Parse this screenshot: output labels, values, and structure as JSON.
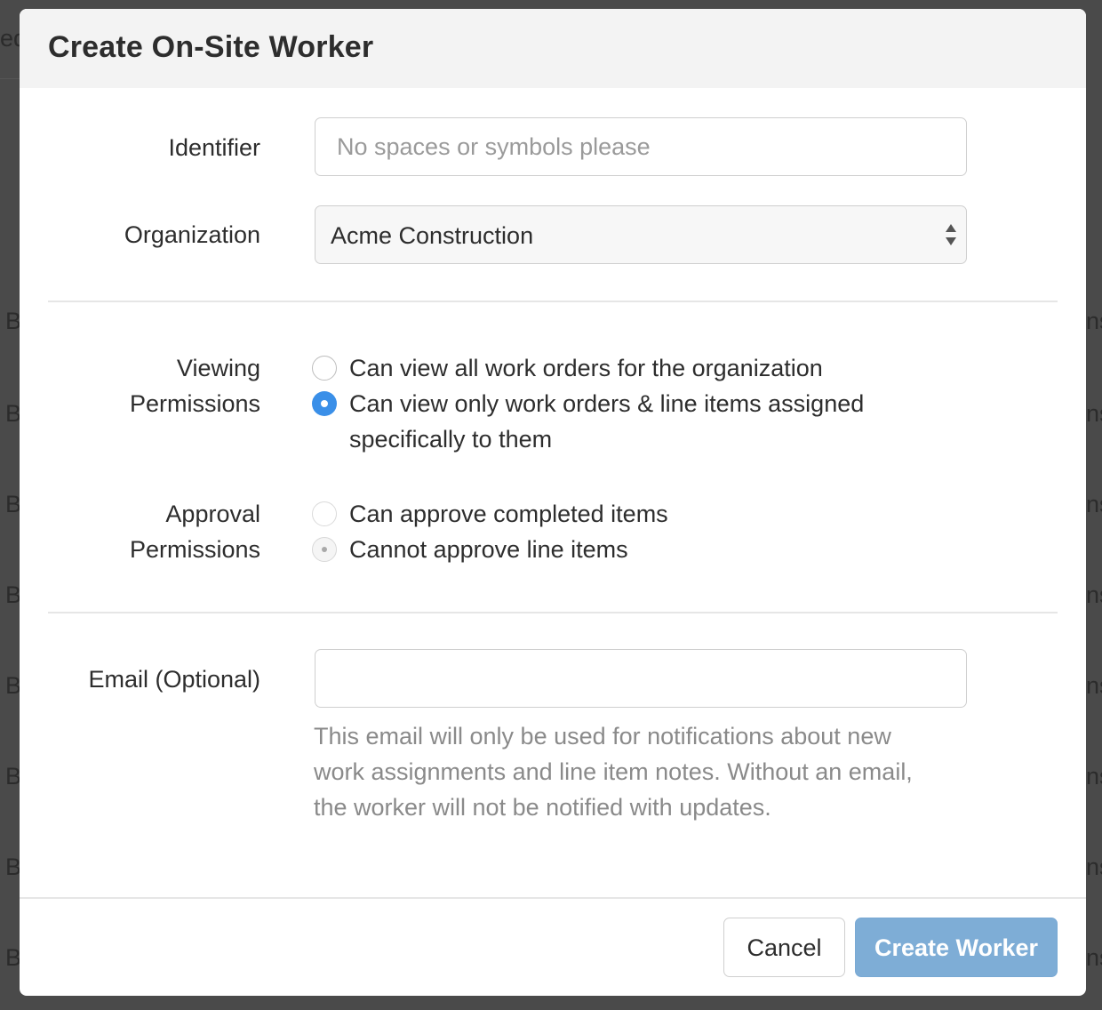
{
  "dialog": {
    "title": "Create On-Site Worker"
  },
  "form": {
    "identifier": {
      "label": "Identifier",
      "value": "",
      "placeholder": "No spaces or symbols please"
    },
    "organization": {
      "label": "Organization",
      "selected": "Acme Construction",
      "icon": "updown-arrows-icon"
    },
    "viewing_permissions": {
      "label_line1": "Viewing",
      "label_line2": "Permissions",
      "options": [
        {
          "label": "Can view all work orders for the organization",
          "checked": false
        },
        {
          "label_line1": "Can view only work orders & line items assigned",
          "label_line2": "specifically to them",
          "checked": true
        }
      ]
    },
    "approval_permissions": {
      "label_line1": "Approval",
      "label_line2": "Permissions",
      "options": [
        {
          "label": "Can approve completed items",
          "checked": false,
          "disabled": true
        },
        {
          "label": "Cannot approve line items",
          "checked": true,
          "disabled": true
        }
      ]
    },
    "email": {
      "label": "Email (Optional)",
      "value": "",
      "placeholder": "",
      "help_line1": "This email will only be used for notifications about new",
      "help_line2": "work assignments and line item notes. Without an email,",
      "help_line3": "the worker will not be notified with updates."
    }
  },
  "footer": {
    "cancel_label": "Cancel",
    "submit_label": "Create Worker"
  },
  "colors": {
    "accent": "#3a8fe8",
    "primary_button": "#7eadd6",
    "overlay": "#4a4a4a"
  }
}
